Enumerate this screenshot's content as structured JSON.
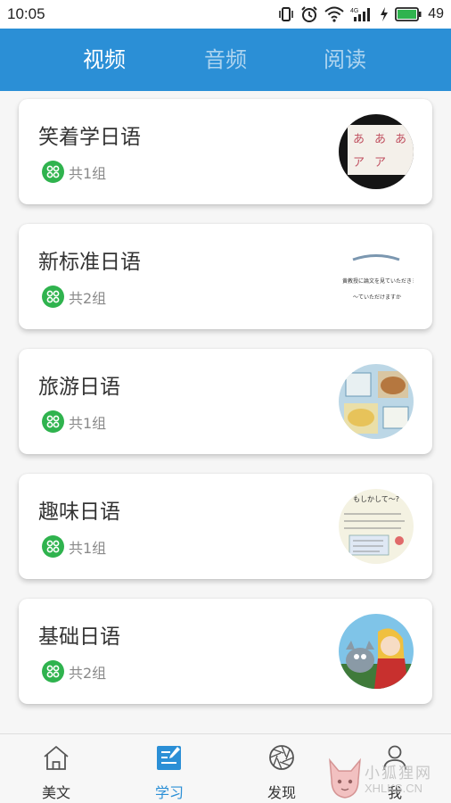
{
  "status_bar": {
    "time": "10:05",
    "battery_level": "49",
    "network": "4G"
  },
  "top_tabs": [
    {
      "label": "视频",
      "active": true
    },
    {
      "label": "音频",
      "active": false
    },
    {
      "label": "阅读",
      "active": false
    }
  ],
  "courses": [
    {
      "title": "笑着学日语",
      "count": "共1组",
      "thumb_icon": "kana-chart-thumbnail"
    },
    {
      "title": "新标准日语",
      "count": "共2组",
      "thumb_icon": "text-slide-thumbnail"
    },
    {
      "title": "旅游日语",
      "count": "共1组",
      "thumb_icon": "food-menu-thumbnail"
    },
    {
      "title": "趣味日语",
      "count": "共1组",
      "thumb_icon": "dialogue-card-thumbnail"
    },
    {
      "title": "基础日语",
      "count": "共2组",
      "thumb_icon": "anime-girl-thumbnail"
    }
  ],
  "thumb_text": {
    "kana_top": [
      "あ",
      "あ",
      "あ"
    ],
    "kana_bottom": [
      "ア",
      "ア"
    ],
    "slide_line1": "黄教授に論文を見ていただきまし",
    "slide_line2": "～ていただけますか",
    "dialogue_title": "もしかして～?"
  },
  "bottom_nav": [
    {
      "label": "美文",
      "icon": "home-icon",
      "active": false
    },
    {
      "label": "学习",
      "icon": "edit-note-icon",
      "active": true
    },
    {
      "label": "发现",
      "icon": "aperture-icon",
      "active": false
    },
    {
      "label": "我",
      "icon": "person-icon",
      "active": false
    }
  ],
  "watermark": {
    "line1": "小狐狸网",
    "line2": "XHLKS.CN"
  },
  "colors": {
    "accent": "#2b8fd6",
    "group_icon": "#2fb34e",
    "battery": "#2fb34e"
  }
}
